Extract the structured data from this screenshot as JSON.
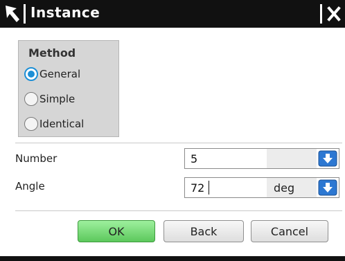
{
  "window": {
    "title": "Instance",
    "icons": {
      "corner": "arrow-icon",
      "close": "close-icon"
    }
  },
  "method": {
    "title": "Method",
    "options": [
      {
        "label": "General",
        "checked": true
      },
      {
        "label": "Simple",
        "checked": false
      },
      {
        "label": "Identical",
        "checked": false
      }
    ]
  },
  "fields": {
    "number": {
      "label": "Number",
      "value": "5"
    },
    "angle": {
      "label": "Angle",
      "value": "72",
      "unit": "deg"
    }
  },
  "buttons": {
    "ok": "OK",
    "back": "Back",
    "cancel": "Cancel"
  },
  "colors": {
    "titlebar": "#111111",
    "accent": "#1d8fd6",
    "ok_button": "#7ddc7d"
  }
}
